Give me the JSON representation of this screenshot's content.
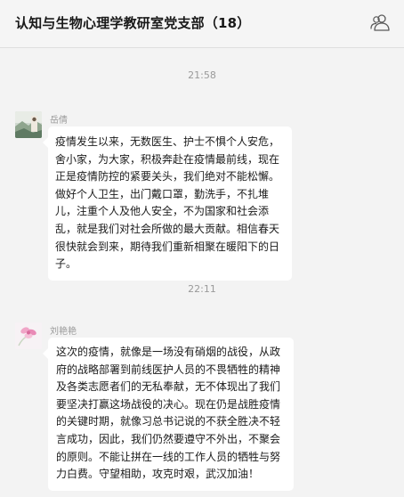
{
  "header": {
    "title": "认知与生物心理学教研室党支部（18）",
    "members_icon": "group-members-icon"
  },
  "messages": [
    {
      "time": "21:58",
      "sender": "岳倩",
      "avatar_icon": "landscape-photo-avatar",
      "text": "疫情发生以来，无数医生、护士不惧个人安危，舍小家，为大家，积极奔赴在疫情最前线，现在正是疫情防控的紧要关头，我们绝对不能松懈。做好个人卫生，出门戴口罩，勤洗手，不扎堆儿，注重个人及他人安全，不为国家和社会添乱，就是我们对社会所做的最大贡献。相信春天很快就会到来，期待我们重新相聚在暖阳下的日子。"
    },
    {
      "time": "22:11",
      "sender": "刘艳艳",
      "avatar_icon": "pink-flower-avatar",
      "text": "这次的疫情，就像是一场没有硝烟的战役，从政府的战略部署到前线医护人员的不畏牺牲的精神及各类志愿者们的无私奉献，无不体现出了我们要坚决打赢这场战役的决心。现在仍是战胜疫情的关键时期，就像习总书记说的不获全胜决不轻言成功，因此，我们仍然要遵守不外出，不聚会的原则。不能让拼在一线的工作人员的牺牲与努力白费。守望相助，攻克时艰，武汉加油！"
    }
  ]
}
